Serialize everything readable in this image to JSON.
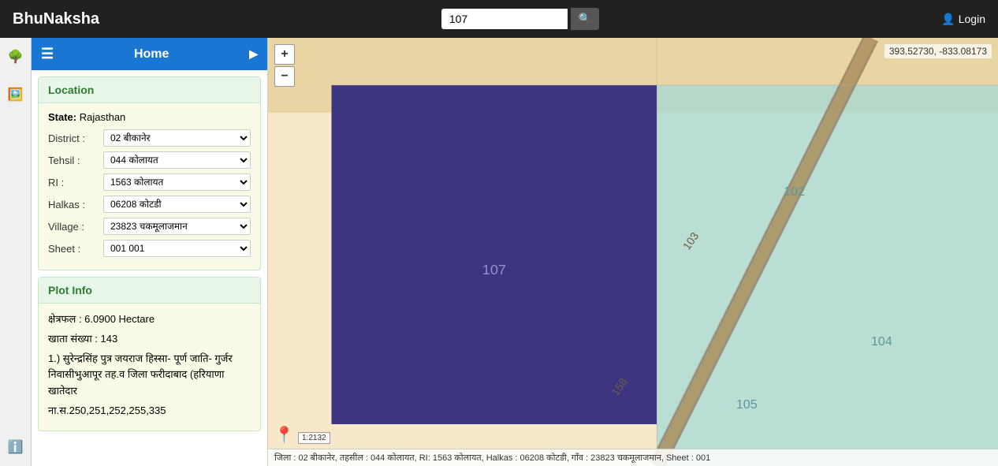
{
  "navbar": {
    "brand": "BhuNaksha",
    "search_placeholder": "107",
    "search_value": "107",
    "search_icon": "🔍",
    "login_label": "Login",
    "login_icon": "👤"
  },
  "sidebar": {
    "icons": [
      "🌳",
      "🖼️",
      "ℹ️"
    ],
    "home_label": "Home"
  },
  "location": {
    "title": "Location",
    "state_label": "State:",
    "state_value": "Rajasthan",
    "district_label": "District :",
    "district_value": "02 बीकानेर",
    "tehsil_label": "Tehsil :",
    "tehsil_value": "044 कोलायत",
    "ri_label": "RI :",
    "ri_value": "1563 कोलायत",
    "halkas_label": "Halkas :",
    "halkas_value": "06208 कोटडी",
    "village_label": "Village :",
    "village_value": "23823 चकमूलाजमान",
    "sheet_label": "Sheet :",
    "sheet_value": "001 001"
  },
  "plot_info": {
    "title": "Plot Info",
    "area_label": "क्षेत्रफल : 6.0900 Hectare",
    "account_label": "खाता संख्या : 143",
    "owner_info": "1.) सुरेन्द्रसिंह पुत्र जयराज हिस्सा- पूर्ण जाति- गुर्जर निवासीभुआपूर तह.व जिला फरीदाबाद (हरियाणा खातेदार",
    "khasra": "ना.स.250,251,252,255,335"
  },
  "map": {
    "coordinates": "393.52730, -833.08173",
    "plot_number": "107",
    "adjacent_plots": [
      "102",
      "104",
      "105"
    ],
    "status_bar": "जिला : 02 बीकानेर, तहसील : 044 कोलायत, RI: 1563 कोलायत, Halkas : 06208 कोटडी, गाँव : 23823 चकमूलाजमान, Sheet : 001",
    "scale": "1:2132",
    "plus_label": "+",
    "minus_label": "−"
  }
}
